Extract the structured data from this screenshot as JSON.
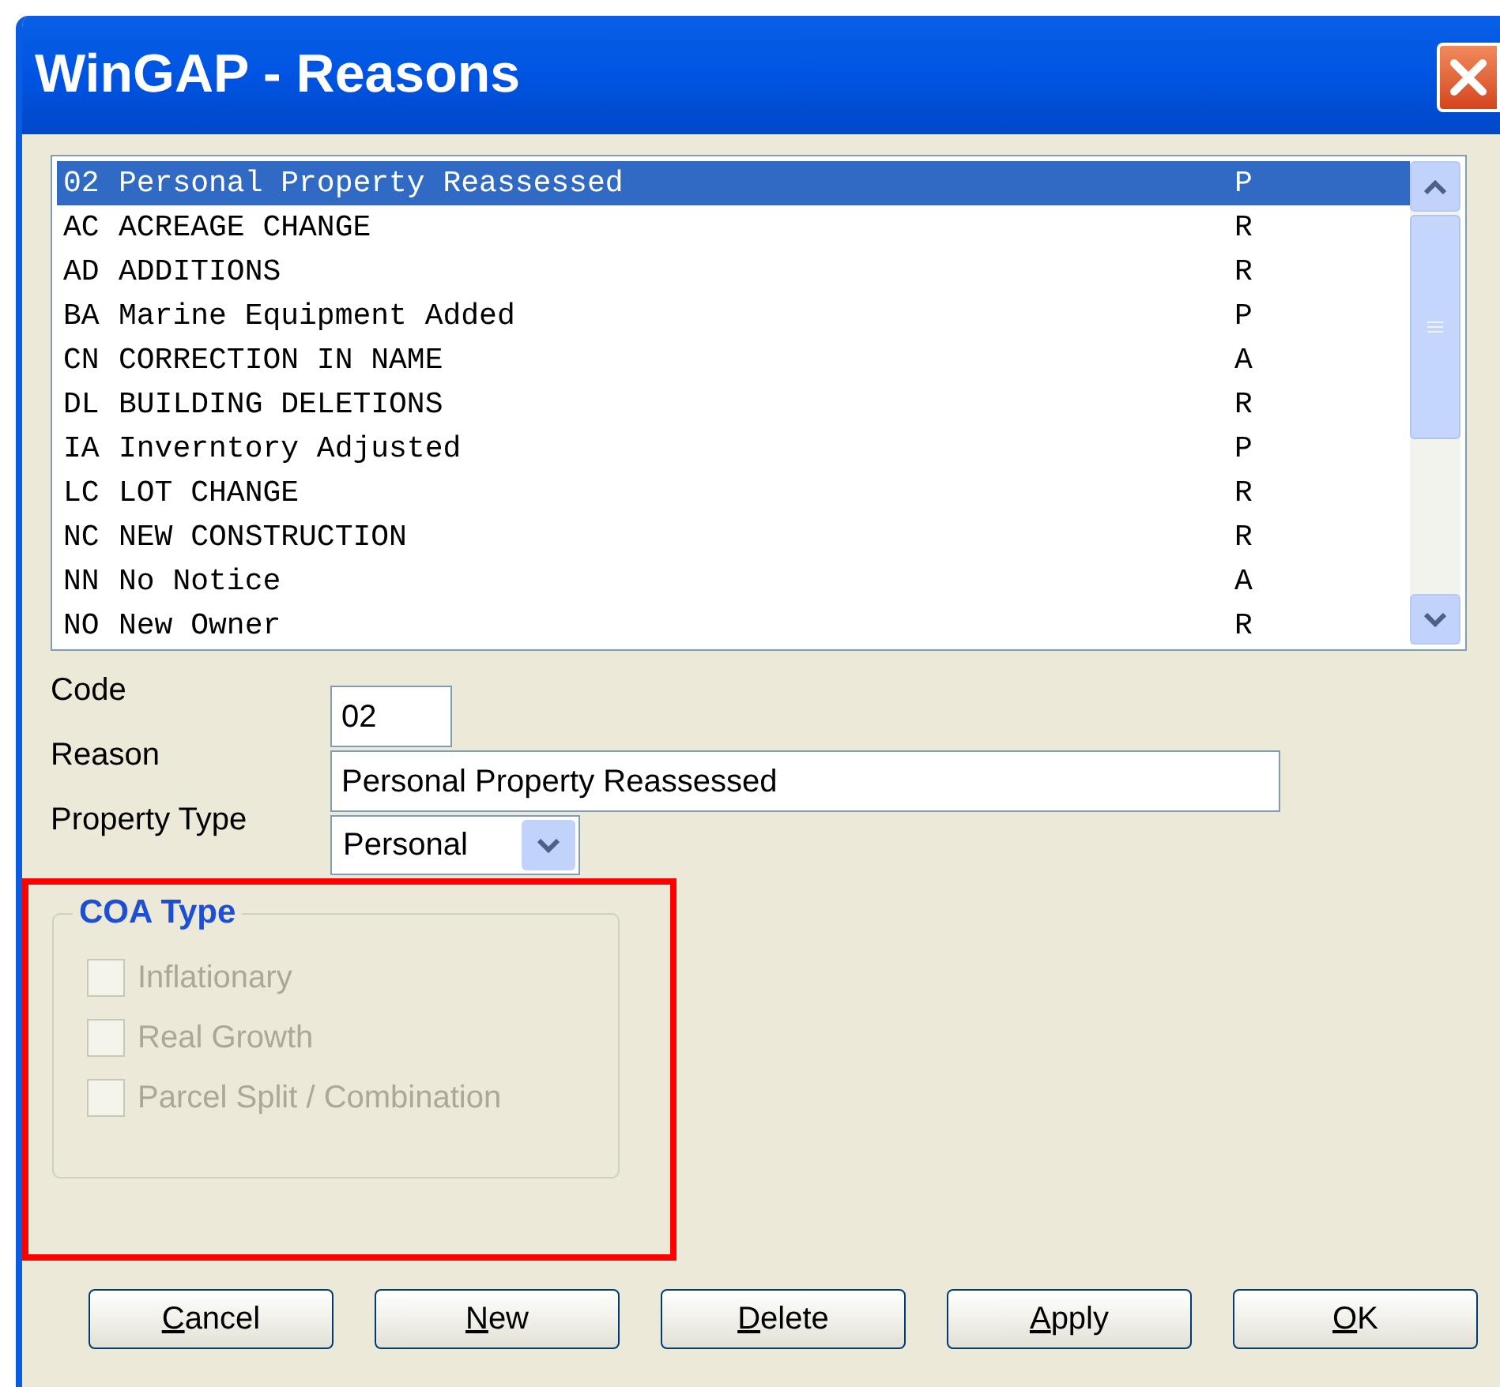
{
  "window": {
    "title": "WinGAP - Reasons"
  },
  "reasons_list": {
    "rows": [
      {
        "code": "02",
        "description": "Personal Property Reassessed",
        "type": "P",
        "selected": true
      },
      {
        "code": "AC",
        "description": "ACREAGE CHANGE",
        "type": "R",
        "selected": false
      },
      {
        "code": "AD",
        "description": "ADDITIONS",
        "type": "R",
        "selected": false
      },
      {
        "code": "BA",
        "description": "Marine Equipment Added",
        "type": "P",
        "selected": false
      },
      {
        "code": "CN",
        "description": "CORRECTION IN NAME",
        "type": "A",
        "selected": false
      },
      {
        "code": "DL",
        "description": "BUILDING DELETIONS",
        "type": "R",
        "selected": false
      },
      {
        "code": "IA",
        "description": "Inverntory Adjusted",
        "type": "P",
        "selected": false
      },
      {
        "code": "LC",
        "description": "LOT CHANGE",
        "type": "R",
        "selected": false
      },
      {
        "code": "NC",
        "description": "NEW CONSTRUCTION",
        "type": "R",
        "selected": false
      },
      {
        "code": "NN",
        "description": "No Notice",
        "type": "A",
        "selected": false
      },
      {
        "code": "NO",
        "description": "New Owner",
        "type": "R",
        "selected": false
      }
    ]
  },
  "form": [
    {
      "kind": "text",
      "label": "Code",
      "value": "02"
    },
    {
      "kind": "text",
      "label": "Reason",
      "value": "Personal Property Reassessed"
    },
    {
      "kind": "select",
      "label": "Property Type",
      "value": "Personal"
    }
  ],
  "coa_type": {
    "title": "COA Type",
    "highlighted": true,
    "options": [
      {
        "label": "Inflationary",
        "checked": false,
        "disabled": true
      },
      {
        "label": "Real Growth",
        "checked": false,
        "disabled": true
      },
      {
        "label": "Parcel Split / Combination",
        "checked": false,
        "disabled": true
      }
    ]
  },
  "buttons": [
    {
      "label": "Cancel",
      "mnemonic": true
    },
    {
      "label": "New",
      "mnemonic": true
    },
    {
      "label": "Delete",
      "mnemonic": true
    },
    {
      "label": "Apply",
      "mnemonic": true
    },
    {
      "label": "OK",
      "mnemonic": true
    }
  ]
}
